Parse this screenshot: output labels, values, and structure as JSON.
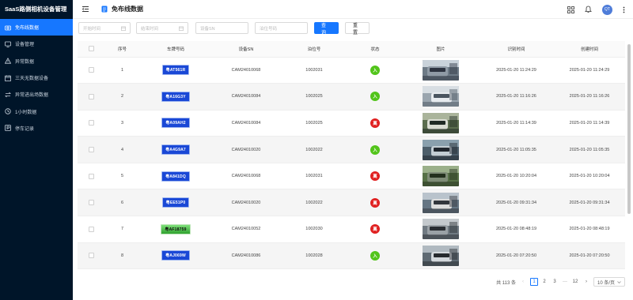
{
  "app": {
    "title": "SaaS路侧相机设备管理"
  },
  "sidebar": {
    "items": [
      {
        "label": "免布线数据",
        "icon": "camera-icon",
        "active": true
      },
      {
        "label": "设备管理",
        "icon": "device-icon"
      },
      {
        "label": "异常数据",
        "icon": "warning-icon"
      },
      {
        "label": "三天无数据设备",
        "icon": "calendar-icon"
      },
      {
        "label": "异常进出场数据",
        "icon": "exchange-icon"
      },
      {
        "label": "1小时数据",
        "icon": "clock-icon"
      },
      {
        "label": "停车记录",
        "icon": "parking-icon"
      }
    ]
  },
  "header": {
    "page_title": "免布线数据",
    "avatar_text": "QT"
  },
  "filters": {
    "start_placeholder": "开始时间",
    "end_placeholder": "结束时间",
    "sn_placeholder": "设备SN",
    "berth_placeholder": "泊位号码",
    "search_label": "查 询",
    "reset_label": "重 置"
  },
  "table": {
    "columns": [
      "",
      "序号",
      "车牌号码",
      "设备SN",
      "泊位号",
      "状态",
      "图片",
      "识别时间",
      "创建时间"
    ],
    "rows": [
      {
        "idx": "1",
        "plate": "粤AT561R",
        "plate_color": "blue",
        "sn": "CAM24010068",
        "berth": "1002031",
        "status": "入",
        "status_type": "in",
        "recog_time": "2025-01-20 11:24:29",
        "create_time": "2025-01-20 11:24:29"
      },
      {
        "idx": "2",
        "plate": "粤A16G3Y",
        "plate_color": "blue",
        "sn": "CAM24010084",
        "berth": "1002025",
        "status": "入",
        "status_type": "in",
        "recog_time": "2025-01-20 11:16:26",
        "create_time": "2025-01-20 11:16:26"
      },
      {
        "idx": "3",
        "plate": "粤A09AH2",
        "plate_color": "blue",
        "sn": "CAM24010084",
        "berth": "1002025",
        "status": "离",
        "status_type": "out",
        "recog_time": "2025-01-20 11:14:39",
        "create_time": "2025-01-20 11:14:39"
      },
      {
        "idx": "4",
        "plate": "粤A4G9A7",
        "plate_color": "blue",
        "sn": "CAM24010020",
        "berth": "1002022",
        "status": "入",
        "status_type": "in",
        "recog_time": "2025-01-20 11:05:35",
        "create_time": "2025-01-20 11:05:35"
      },
      {
        "idx": "5",
        "plate": "粤A841DQ",
        "plate_color": "blue",
        "sn": "CAM24010068",
        "berth": "1002031",
        "status": "离",
        "status_type": "out",
        "recog_time": "2025-01-20 10:20:04",
        "create_time": "2025-01-20 10:20:04"
      },
      {
        "idx": "6",
        "plate": "粤EE51P0",
        "plate_color": "blue",
        "sn": "CAM24010020",
        "berth": "1002022",
        "status": "离",
        "status_type": "out",
        "recog_time": "2025-01-20 09:31:34",
        "create_time": "2025-01-20 09:31:34"
      },
      {
        "idx": "7",
        "plate": "粤AF18759",
        "plate_color": "green",
        "sn": "CAM24010052",
        "berth": "1002030",
        "status": "离",
        "status_type": "out",
        "recog_time": "2025-01-20 08:48:19",
        "create_time": "2025-01-20 08:48:19"
      },
      {
        "idx": "8",
        "plate": "粤AJ069W",
        "plate_color": "blue",
        "sn": "CAM24010086",
        "berth": "1002028",
        "status": "入",
        "status_type": "in",
        "recog_time": "2025-01-20 07:20:50",
        "create_time": "2025-01-20 07:20:50"
      }
    ]
  },
  "pagination": {
    "total_text": "共 113 条",
    "pages": [
      "1",
      "2",
      "3",
      "···",
      "12"
    ],
    "current": "1",
    "page_size": "10 条/页"
  },
  "colors": {
    "primary": "#1677ff",
    "sidebar_bg": "#001529",
    "status_in": "#52c41a",
    "status_out": "#e02020"
  }
}
